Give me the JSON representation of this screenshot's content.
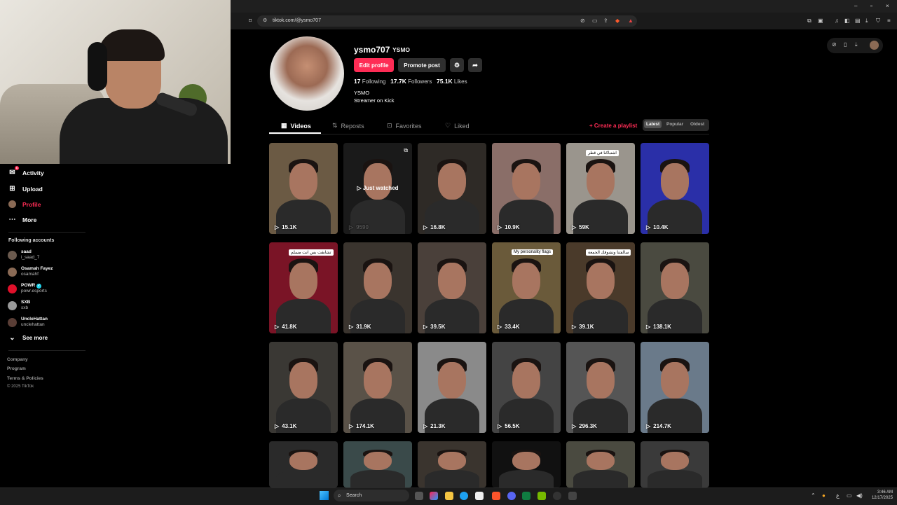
{
  "browser": {
    "url": "tiktok.com/@ysmo707",
    "window_controls": [
      "–",
      "▫",
      "×"
    ]
  },
  "sidebar": {
    "items": [
      {
        "label": "Activity",
        "icon": "activity-icon",
        "badge": "6"
      },
      {
        "label": "Upload",
        "icon": "upload-icon"
      },
      {
        "label": "Profile",
        "icon": "profile-avatar-icon"
      },
      {
        "label": "More",
        "icon": "more-icon"
      }
    ],
    "following_heading": "Following accounts",
    "accounts": [
      {
        "name": "saad",
        "handle": "i_saad_7",
        "color": "#6b5a4e"
      },
      {
        "name": "Osamah Fayez",
        "handle": "osamahf",
        "color": "#8a6a55"
      },
      {
        "name": "POWR",
        "handle": "powr.esports",
        "color": "#e0102a",
        "verified": "✓"
      },
      {
        "name": "SXB",
        "handle": "sxb",
        "color": "#999999"
      },
      {
        "name": "UncleHattan",
        "handle": "unclehattan",
        "color": "#5a3e36"
      }
    ],
    "see_more": "See more",
    "footer": [
      "Company",
      "Program",
      "Terms & Policies",
      "© 2025 TikTok"
    ]
  },
  "profile": {
    "username": "ysmo707",
    "nickname": "YSMO",
    "edit_label": "Edit profile",
    "promote_label": "Promote post",
    "following_count": "17",
    "following_label": "Following",
    "followers_count": "17.7K",
    "followers_label": "Followers",
    "likes_count": "75.1K",
    "likes_label": "Likes",
    "bio_line1": "YSMO",
    "bio_line2": "Streamer on Kick"
  },
  "tabs": [
    {
      "label": "Videos",
      "icon": "grid-icon"
    },
    {
      "label": "Reposts",
      "icon": "repost-icon"
    },
    {
      "label": "Favorites",
      "icon": "bookmark-icon"
    },
    {
      "label": "Liked",
      "icon": "heart-outline-icon"
    }
  ],
  "create_playlist": "Create a playlist",
  "sort": [
    "Latest",
    "Popular",
    "Oldest"
  ],
  "videos": [
    {
      "views": "15.1K",
      "bg": "#6b5a44"
    },
    {
      "views": "9590",
      "bg": "#1a1a1a",
      "overlay": "Just watched"
    },
    {
      "views": "16.8K",
      "bg": "#2e2a26"
    },
    {
      "views": "10.9K",
      "bg": "#8a6e68"
    },
    {
      "views": "59K",
      "bg": "#9a958d",
      "caption": "اشتباكنا في قطر"
    },
    {
      "views": "10.4K",
      "bg": "#2a2fa8"
    },
    {
      "views": "41.8K",
      "bg": "#7a1426",
      "caption": "تشابقت بس انت مسلم"
    },
    {
      "views": "31.9K",
      "bg": "#3a342e"
    },
    {
      "views": "39.5K",
      "bg": "#4a403a"
    },
    {
      "views": "33.4K",
      "bg": "#6a5a3a",
      "caption": "My personality flags"
    },
    {
      "views": "39.1K",
      "bg": "#4a3a2a",
      "caption": "سالفتنا ونشوفك الجمعة"
    },
    {
      "views": "138.1K",
      "bg": "#4a4a40"
    },
    {
      "views": "43.1K",
      "bg": "#3a3834"
    },
    {
      "views": "174.1K",
      "bg": "#5a5248"
    },
    {
      "views": "21.3K",
      "bg": "#8a8a8a"
    },
    {
      "views": "56.5K",
      "bg": "#444444"
    },
    {
      "views": "296.3K",
      "bg": "#555555"
    },
    {
      "views": "214.7K",
      "bg": "#6a7a8a"
    },
    {
      "views": "",
      "bg": "#2a2a2a"
    },
    {
      "views": "",
      "bg": "#3a4a4a"
    },
    {
      "views": "",
      "bg": "#3a342e"
    },
    {
      "views": "",
      "bg": "#111111"
    },
    {
      "views": "",
      "bg": "#4a4a40"
    },
    {
      "views": "",
      "bg": "#3a3a3a"
    }
  ],
  "taskbar": {
    "search_placeholder": "Search",
    "time": "3:46 AM",
    "date": "12/17/2025",
    "lang": "ع"
  }
}
